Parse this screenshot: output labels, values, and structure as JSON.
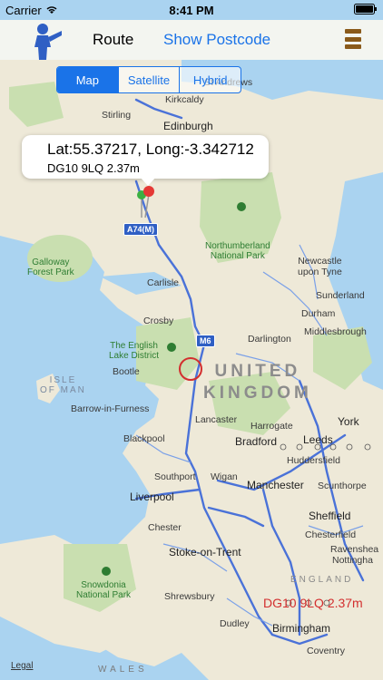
{
  "status_bar": {
    "carrier": "Carrier",
    "time": "8:41 PM"
  },
  "nav": {
    "route_label": "Route",
    "postcode_label": "Show Postcode"
  },
  "map_type": {
    "options": [
      "Map",
      "Satellite",
      "Hybrid"
    ],
    "selected": "Map"
  },
  "callout": {
    "coords": "Lat:55.37217, Long:-3.342712",
    "subtitle": "DG10 9LQ 2.37m"
  },
  "overlay_text": "DG10 9LQ 2.37m",
  "legal": "Legal",
  "road_shields": {
    "a74m": "A74(M)",
    "m6": "M6"
  },
  "labels": {
    "stirling": "Stirling",
    "edinburgh": "Edinburgh",
    "kirkcaldy": "Kirkcaldy",
    "st_andrews": "St Andrews",
    "galloway": "Galloway\nForest Park",
    "northumberland": "Northumberland\nNational Park",
    "newcastle": "Newcastle\nupon Tyne",
    "sunderland": "Sunderland",
    "durham": "Durham",
    "carlisle": "Carlisle",
    "crosby": "Crosby",
    "lake_district": "The English\nLake District",
    "middlesbrough": "Middlesbrough",
    "darlington": "Darlington",
    "bootle": "Bootle",
    "isle_of_man": "ISLE\nOF MAN",
    "united_kingdom": "UNITED\nKINGDOM",
    "barrow": "Barrow-in-Furness",
    "lancaster": "Lancaster",
    "harrogate": "Harrogate",
    "york": "York",
    "blackpool": "Blackpool",
    "bradford": "Bradford",
    "leeds": "Leeds",
    "huddersfield": "Huddersfield",
    "southport": "Southport",
    "wigan": "Wigan",
    "manchester": "Manchester",
    "scunthorpe": "Scunthorpe",
    "liverpool": "Liverpool",
    "sheffield": "Sheffield",
    "chester": "Chester",
    "chesterfield": "Chesterfield",
    "ravenshead": "Ravenshea",
    "stoke": "Stoke-on-Trent",
    "nottingham": "Nottingha",
    "snowdonia": "Snowdonia\nNational Park",
    "england": "ENGLAND",
    "shrewsbury": "Shrewsbury",
    "dudley": "Dudley",
    "birmingham": "Birmingham",
    "coventry": "Coventry",
    "wales": "WALES"
  },
  "colors": {
    "accent": "#1a73e8",
    "land": "#eee9d8",
    "sea": "#aad3f0",
    "park": "#c9dfb0",
    "road": "#4a72d8",
    "overlay_red": "#d32f2f",
    "menu_brown": "#8a5a1a"
  },
  "icons": [
    "person-icon",
    "menu-icon",
    "pin-green",
    "pin-red",
    "park-tree-icon",
    "location-circle"
  ]
}
